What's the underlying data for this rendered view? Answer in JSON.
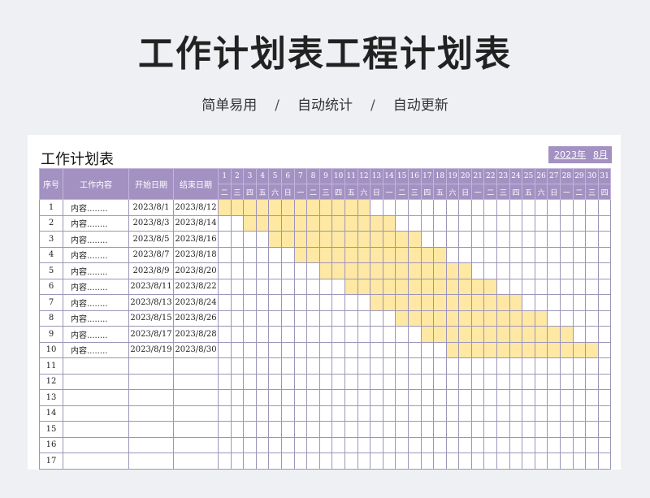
{
  "header": {
    "title": "工作计划表工程计划表",
    "subtitle_items": [
      "简单易用",
      "自动统计",
      "自动更新"
    ],
    "subtitle_sep": "/"
  },
  "sheet": {
    "title": "工作计划表",
    "year": "2023年",
    "month": "8月",
    "columns": {
      "index": "序号",
      "task": "工作内容",
      "start": "开始日期",
      "end": "结束日期"
    },
    "days": [
      "1",
      "2",
      "3",
      "4",
      "5",
      "6",
      "7",
      "8",
      "9",
      "10",
      "11",
      "12",
      "13",
      "14",
      "15",
      "16",
      "17",
      "18",
      "19",
      "20",
      "21",
      "22",
      "23",
      "24",
      "25",
      "26",
      "27",
      "28",
      "29",
      "30",
      "31"
    ],
    "weekdays": [
      "二",
      "三",
      "四",
      "五",
      "六",
      "日",
      "一",
      "二",
      "三",
      "四",
      "五",
      "六",
      "日",
      "一",
      "二",
      "三",
      "四",
      "五",
      "六",
      "日",
      "一",
      "二",
      "三",
      "四",
      "五",
      "六",
      "日",
      "一",
      "二",
      "三",
      "四"
    ],
    "rows": [
      {
        "no": "1",
        "task": "内容........",
        "start": "2023/8/1",
        "end": "2023/8/12",
        "s": 1,
        "e": 12
      },
      {
        "no": "2",
        "task": "内容........",
        "start": "2023/8/3",
        "end": "2023/8/14",
        "s": 3,
        "e": 14
      },
      {
        "no": "3",
        "task": "内容........",
        "start": "2023/8/5",
        "end": "2023/8/16",
        "s": 5,
        "e": 16
      },
      {
        "no": "4",
        "task": "内容........",
        "start": "2023/8/7",
        "end": "2023/8/18",
        "s": 7,
        "e": 18
      },
      {
        "no": "5",
        "task": "内容........",
        "start": "2023/8/9",
        "end": "2023/8/20",
        "s": 9,
        "e": 20
      },
      {
        "no": "6",
        "task": "内容........",
        "start": "2023/8/11",
        "end": "2023/8/22",
        "s": 11,
        "e": 22
      },
      {
        "no": "7",
        "task": "内容........",
        "start": "2023/8/13",
        "end": "2023/8/24",
        "s": 13,
        "e": 24
      },
      {
        "no": "8",
        "task": "内容........",
        "start": "2023/8/15",
        "end": "2023/8/26",
        "s": 15,
        "e": 26
      },
      {
        "no": "9",
        "task": "内容........",
        "start": "2023/8/17",
        "end": "2023/8/28",
        "s": 17,
        "e": 28
      },
      {
        "no": "10",
        "task": "内容........",
        "start": "2023/8/19",
        "end": "2023/8/30",
        "s": 19,
        "e": 30
      },
      {
        "no": "11",
        "task": "",
        "start": "",
        "end": ""
      },
      {
        "no": "12",
        "task": "",
        "start": "",
        "end": ""
      },
      {
        "no": "13",
        "task": "",
        "start": "",
        "end": ""
      },
      {
        "no": "14",
        "task": "",
        "start": "",
        "end": ""
      },
      {
        "no": "15",
        "task": "",
        "start": "",
        "end": ""
      },
      {
        "no": "16",
        "task": "",
        "start": "",
        "end": ""
      },
      {
        "no": "17",
        "task": "",
        "start": "",
        "end": ""
      }
    ],
    "colors": {
      "header_bg": "#a391c2",
      "bar_fill": "#ffe8a3"
    }
  }
}
